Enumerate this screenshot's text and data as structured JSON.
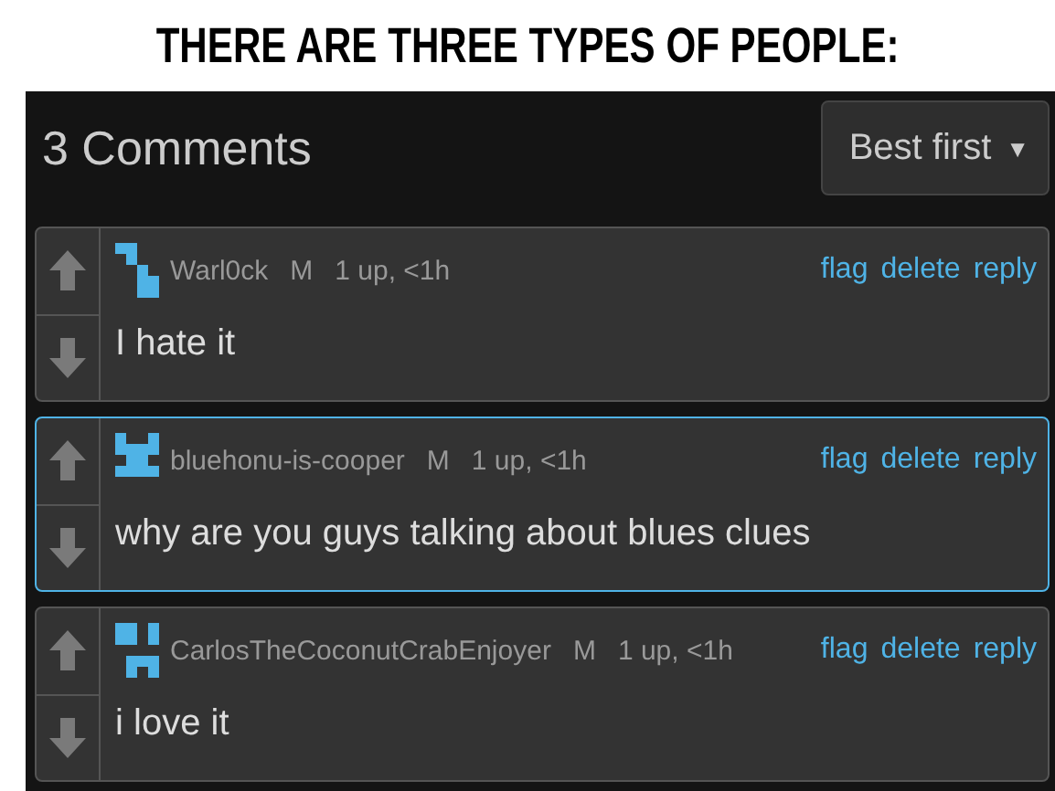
{
  "caption": "THERE ARE THREE TYPES OF PEOPLE:",
  "header": {
    "title": "3 Comments",
    "sort": "Best first",
    "sort_arrow": "▼"
  },
  "comments": [
    {
      "user": "Warl0ck",
      "badge": "M",
      "meta": "1 up, <1h",
      "actions": [
        "flag",
        "delete",
        "reply"
      ],
      "text": "I hate it",
      "selected": false
    },
    {
      "user": "bluehonu-is-cooper",
      "badge": "M",
      "meta": "1 up, <1h",
      "actions": [
        "flag",
        "delete",
        "reply"
      ],
      "text": "why are you guys talking about blues clues",
      "selected": true
    },
    {
      "user": "CarlosTheCoconutCrabEnjoyer",
      "badge": "M",
      "meta": "1 up, <1h",
      "actions": [
        "flag",
        "delete",
        "reply"
      ],
      "text": "i love it",
      "selected": false
    }
  ]
}
